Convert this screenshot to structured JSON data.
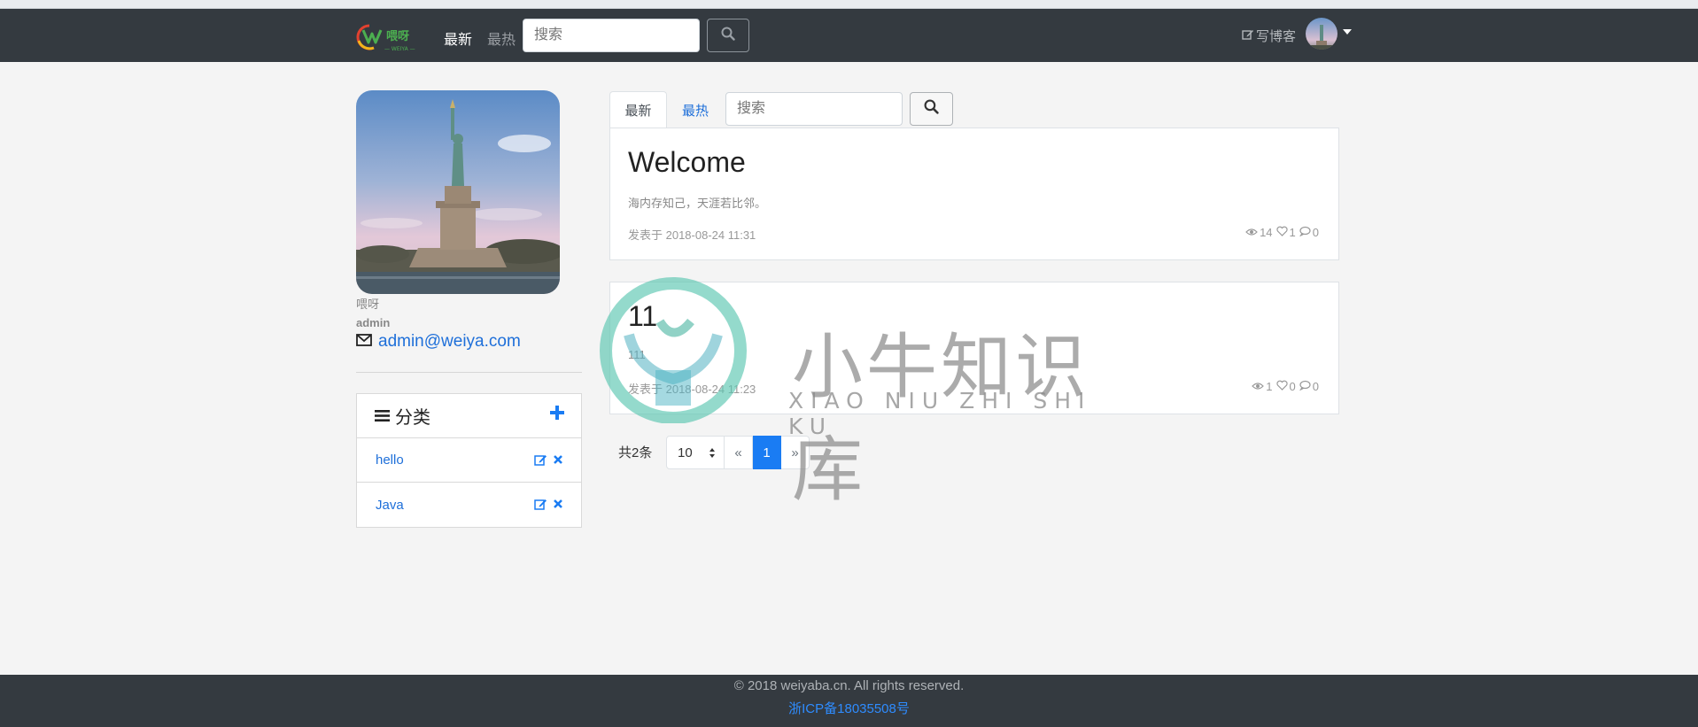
{
  "colors": {
    "navbar_bg": "#343a40",
    "page_bg": "#f4f4f4",
    "link_blue": "#1e6fd9",
    "primary": "#1a7cf3",
    "footer_link": "#2e8cff"
  },
  "navbar": {
    "logo_icon": "weiya-logo-icon",
    "tab_new": "最新",
    "tab_hot": "最热",
    "search_placeholder": "搜索",
    "search_icon": "search-icon",
    "write_label": "写博客",
    "write_icon": "edit-icon",
    "avatar_icon": "avatar",
    "dropdown_icon": "caret-down-icon"
  },
  "profile": {
    "photo": "statue-of-liberty-photo",
    "nickname": "喂呀",
    "username": "admin",
    "email_icon": "envelope-icon",
    "email": "admin@weiya.com"
  },
  "categories": {
    "title": "分类",
    "menu_icon": "bars-icon",
    "add_icon": "plus-icon",
    "items": [
      {
        "label": "hello"
      },
      {
        "label": "Java"
      }
    ],
    "edit_icon": "edit-icon",
    "delete_icon": "times-icon"
  },
  "main": {
    "tab_new": "最新",
    "tab_hot": "最热",
    "search_placeholder": "搜索",
    "search_icon": "search-icon"
  },
  "posts": [
    {
      "title": "Welcome",
      "excerpt": "海内存知己，天涯若比邻。",
      "date": "发表于 2018-08-24 11:31",
      "views": "14",
      "likes": "1",
      "comments": "0"
    },
    {
      "title": "11",
      "excerpt": "111",
      "date": "发表于 2018-08-24 11:23",
      "views": "1",
      "likes": "0",
      "comments": "0"
    }
  ],
  "pagination": {
    "total": "共2条",
    "page_size": "10",
    "prev": "«",
    "current": "1",
    "next": "»"
  },
  "footer": {
    "copyright": "© 2018 weiyaba.cn. All rights reserved.",
    "icp": "浙ICP备18035508号"
  },
  "watermark": {
    "text_cn": "小牛知识库",
    "text_en": "XIAO NIU ZHI SHI KU"
  }
}
